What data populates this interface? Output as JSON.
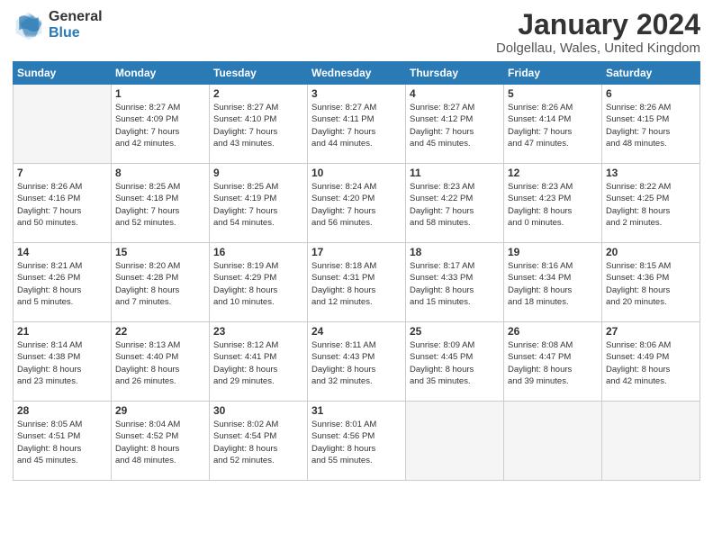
{
  "logo": {
    "general": "General",
    "blue": "Blue"
  },
  "title": {
    "month": "January 2024",
    "location": "Dolgellau, Wales, United Kingdom"
  },
  "headers": [
    "Sunday",
    "Monday",
    "Tuesday",
    "Wednesday",
    "Thursday",
    "Friday",
    "Saturday"
  ],
  "weeks": [
    [
      {
        "num": "",
        "info": ""
      },
      {
        "num": "1",
        "info": "Sunrise: 8:27 AM\nSunset: 4:09 PM\nDaylight: 7 hours\nand 42 minutes."
      },
      {
        "num": "2",
        "info": "Sunrise: 8:27 AM\nSunset: 4:10 PM\nDaylight: 7 hours\nand 43 minutes."
      },
      {
        "num": "3",
        "info": "Sunrise: 8:27 AM\nSunset: 4:11 PM\nDaylight: 7 hours\nand 44 minutes."
      },
      {
        "num": "4",
        "info": "Sunrise: 8:27 AM\nSunset: 4:12 PM\nDaylight: 7 hours\nand 45 minutes."
      },
      {
        "num": "5",
        "info": "Sunrise: 8:26 AM\nSunset: 4:14 PM\nDaylight: 7 hours\nand 47 minutes."
      },
      {
        "num": "6",
        "info": "Sunrise: 8:26 AM\nSunset: 4:15 PM\nDaylight: 7 hours\nand 48 minutes."
      }
    ],
    [
      {
        "num": "7",
        "info": "Sunrise: 8:26 AM\nSunset: 4:16 PM\nDaylight: 7 hours\nand 50 minutes."
      },
      {
        "num": "8",
        "info": "Sunrise: 8:25 AM\nSunset: 4:18 PM\nDaylight: 7 hours\nand 52 minutes."
      },
      {
        "num": "9",
        "info": "Sunrise: 8:25 AM\nSunset: 4:19 PM\nDaylight: 7 hours\nand 54 minutes."
      },
      {
        "num": "10",
        "info": "Sunrise: 8:24 AM\nSunset: 4:20 PM\nDaylight: 7 hours\nand 56 minutes."
      },
      {
        "num": "11",
        "info": "Sunrise: 8:23 AM\nSunset: 4:22 PM\nDaylight: 7 hours\nand 58 minutes."
      },
      {
        "num": "12",
        "info": "Sunrise: 8:23 AM\nSunset: 4:23 PM\nDaylight: 8 hours\nand 0 minutes."
      },
      {
        "num": "13",
        "info": "Sunrise: 8:22 AM\nSunset: 4:25 PM\nDaylight: 8 hours\nand 2 minutes."
      }
    ],
    [
      {
        "num": "14",
        "info": "Sunrise: 8:21 AM\nSunset: 4:26 PM\nDaylight: 8 hours\nand 5 minutes."
      },
      {
        "num": "15",
        "info": "Sunrise: 8:20 AM\nSunset: 4:28 PM\nDaylight: 8 hours\nand 7 minutes."
      },
      {
        "num": "16",
        "info": "Sunrise: 8:19 AM\nSunset: 4:29 PM\nDaylight: 8 hours\nand 10 minutes."
      },
      {
        "num": "17",
        "info": "Sunrise: 8:18 AM\nSunset: 4:31 PM\nDaylight: 8 hours\nand 12 minutes."
      },
      {
        "num": "18",
        "info": "Sunrise: 8:17 AM\nSunset: 4:33 PM\nDaylight: 8 hours\nand 15 minutes."
      },
      {
        "num": "19",
        "info": "Sunrise: 8:16 AM\nSunset: 4:34 PM\nDaylight: 8 hours\nand 18 minutes."
      },
      {
        "num": "20",
        "info": "Sunrise: 8:15 AM\nSunset: 4:36 PM\nDaylight: 8 hours\nand 20 minutes."
      }
    ],
    [
      {
        "num": "21",
        "info": "Sunrise: 8:14 AM\nSunset: 4:38 PM\nDaylight: 8 hours\nand 23 minutes."
      },
      {
        "num": "22",
        "info": "Sunrise: 8:13 AM\nSunset: 4:40 PM\nDaylight: 8 hours\nand 26 minutes."
      },
      {
        "num": "23",
        "info": "Sunrise: 8:12 AM\nSunset: 4:41 PM\nDaylight: 8 hours\nand 29 minutes."
      },
      {
        "num": "24",
        "info": "Sunrise: 8:11 AM\nSunset: 4:43 PM\nDaylight: 8 hours\nand 32 minutes."
      },
      {
        "num": "25",
        "info": "Sunrise: 8:09 AM\nSunset: 4:45 PM\nDaylight: 8 hours\nand 35 minutes."
      },
      {
        "num": "26",
        "info": "Sunrise: 8:08 AM\nSunset: 4:47 PM\nDaylight: 8 hours\nand 39 minutes."
      },
      {
        "num": "27",
        "info": "Sunrise: 8:06 AM\nSunset: 4:49 PM\nDaylight: 8 hours\nand 42 minutes."
      }
    ],
    [
      {
        "num": "28",
        "info": "Sunrise: 8:05 AM\nSunset: 4:51 PM\nDaylight: 8 hours\nand 45 minutes."
      },
      {
        "num": "29",
        "info": "Sunrise: 8:04 AM\nSunset: 4:52 PM\nDaylight: 8 hours\nand 48 minutes."
      },
      {
        "num": "30",
        "info": "Sunrise: 8:02 AM\nSunset: 4:54 PM\nDaylight: 8 hours\nand 52 minutes."
      },
      {
        "num": "31",
        "info": "Sunrise: 8:01 AM\nSunset: 4:56 PM\nDaylight: 8 hours\nand 55 minutes."
      },
      {
        "num": "",
        "info": ""
      },
      {
        "num": "",
        "info": ""
      },
      {
        "num": "",
        "info": ""
      }
    ]
  ]
}
